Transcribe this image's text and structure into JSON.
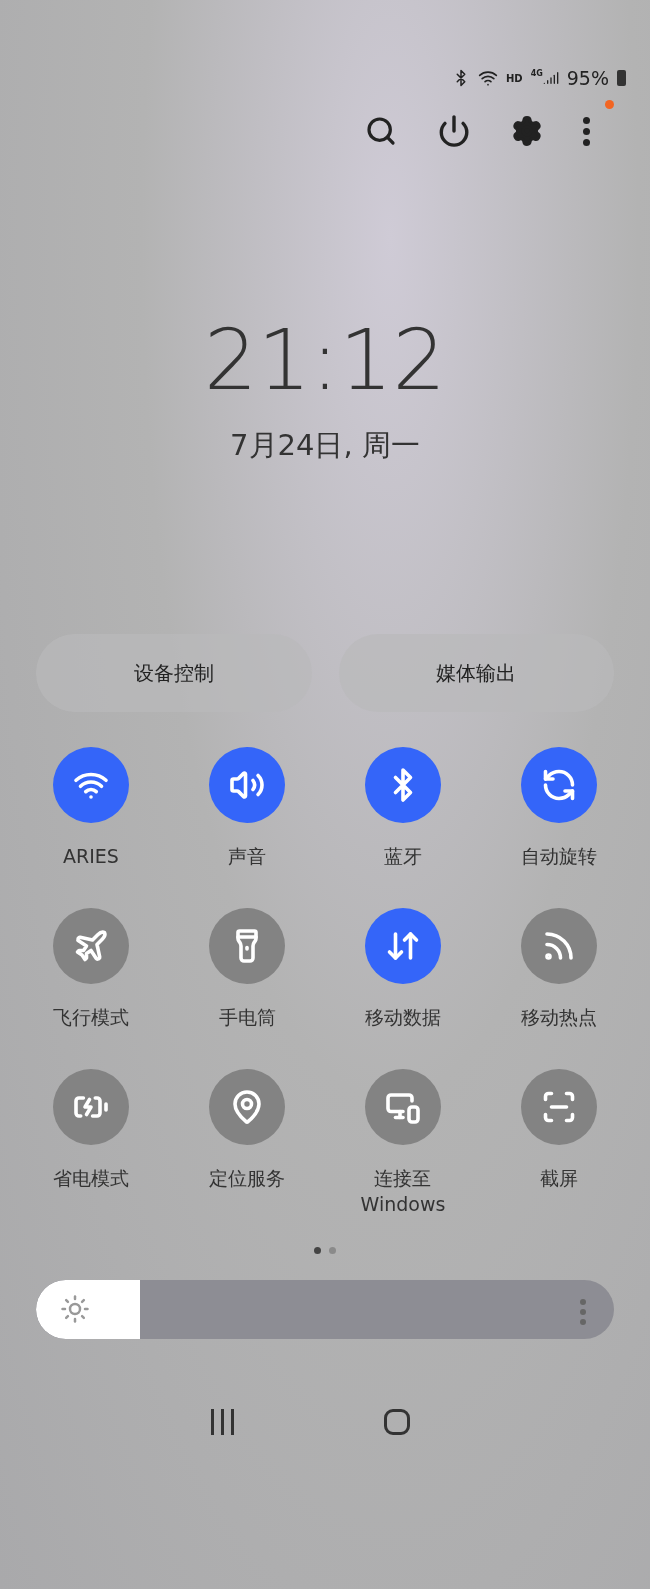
{
  "status_bar": {
    "network_label": "HD",
    "signal_label": "4G",
    "battery": "95%"
  },
  "clock": {
    "time": "21:12",
    "date": "7月24日, 周一"
  },
  "panels": [
    "设备控制",
    "媒体输出"
  ],
  "tiles": [
    {
      "label": "ARIES",
      "on": true
    },
    {
      "label": "声音",
      "on": true
    },
    {
      "label": "蓝牙",
      "on": true
    },
    {
      "label": "自动旋转",
      "on": true
    },
    {
      "label": "飞行模式",
      "on": false
    },
    {
      "label": "手电筒",
      "on": false
    },
    {
      "label": "移动数据",
      "on": true
    },
    {
      "label": "移动热点",
      "on": false
    },
    {
      "label": "省电模式",
      "on": false
    },
    {
      "label": "定位服务",
      "on": false
    },
    {
      "label": "连接至\nWindows",
      "on": false
    },
    {
      "label": "截屏",
      "on": false
    }
  ],
  "pages": [
    {
      "selected": true
    },
    {
      "selected": false
    }
  ],
  "brightness": {
    "level": 0.18
  }
}
